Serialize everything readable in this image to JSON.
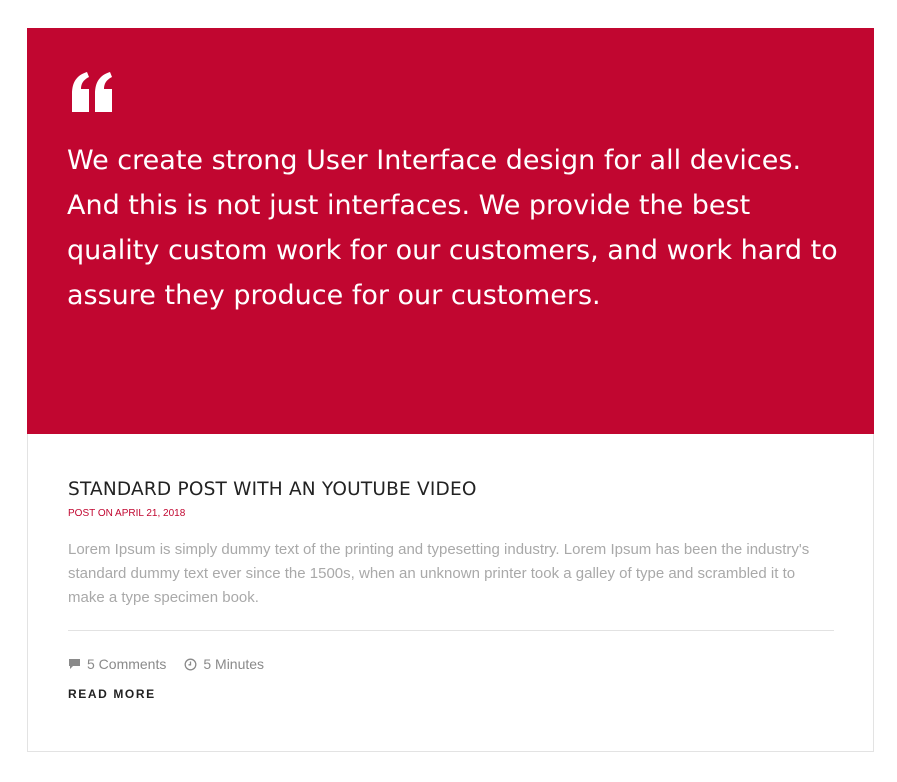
{
  "quote": {
    "icon": "quote-mark-icon",
    "text": "We create strong User Interface design for all devices. And this is not just interfaces. We provide the best quality custom work for our customers, and work hard to assure they produce for our customers.",
    "background_color": "#c10630",
    "text_color": "#ffffff"
  },
  "post": {
    "title": "STANDARD POST WITH AN YOUTUBE VIDEO",
    "meta": "POST ON APRIL 21, 2018",
    "excerpt": "Lorem Ipsum is simply dummy text of the printing and typesetting industry. Lorem Ipsum has been the industry's standard dummy text ever since the 1500s, when an unknown printer took a galley of type and scrambled it to make a type specimen book.",
    "comments": {
      "icon": "comment-icon",
      "label": "5 Comments"
    },
    "read_time": {
      "icon": "clock-icon",
      "label": "5 Minutes"
    },
    "read_more": "READ MORE",
    "accent_color": "#c10630"
  }
}
